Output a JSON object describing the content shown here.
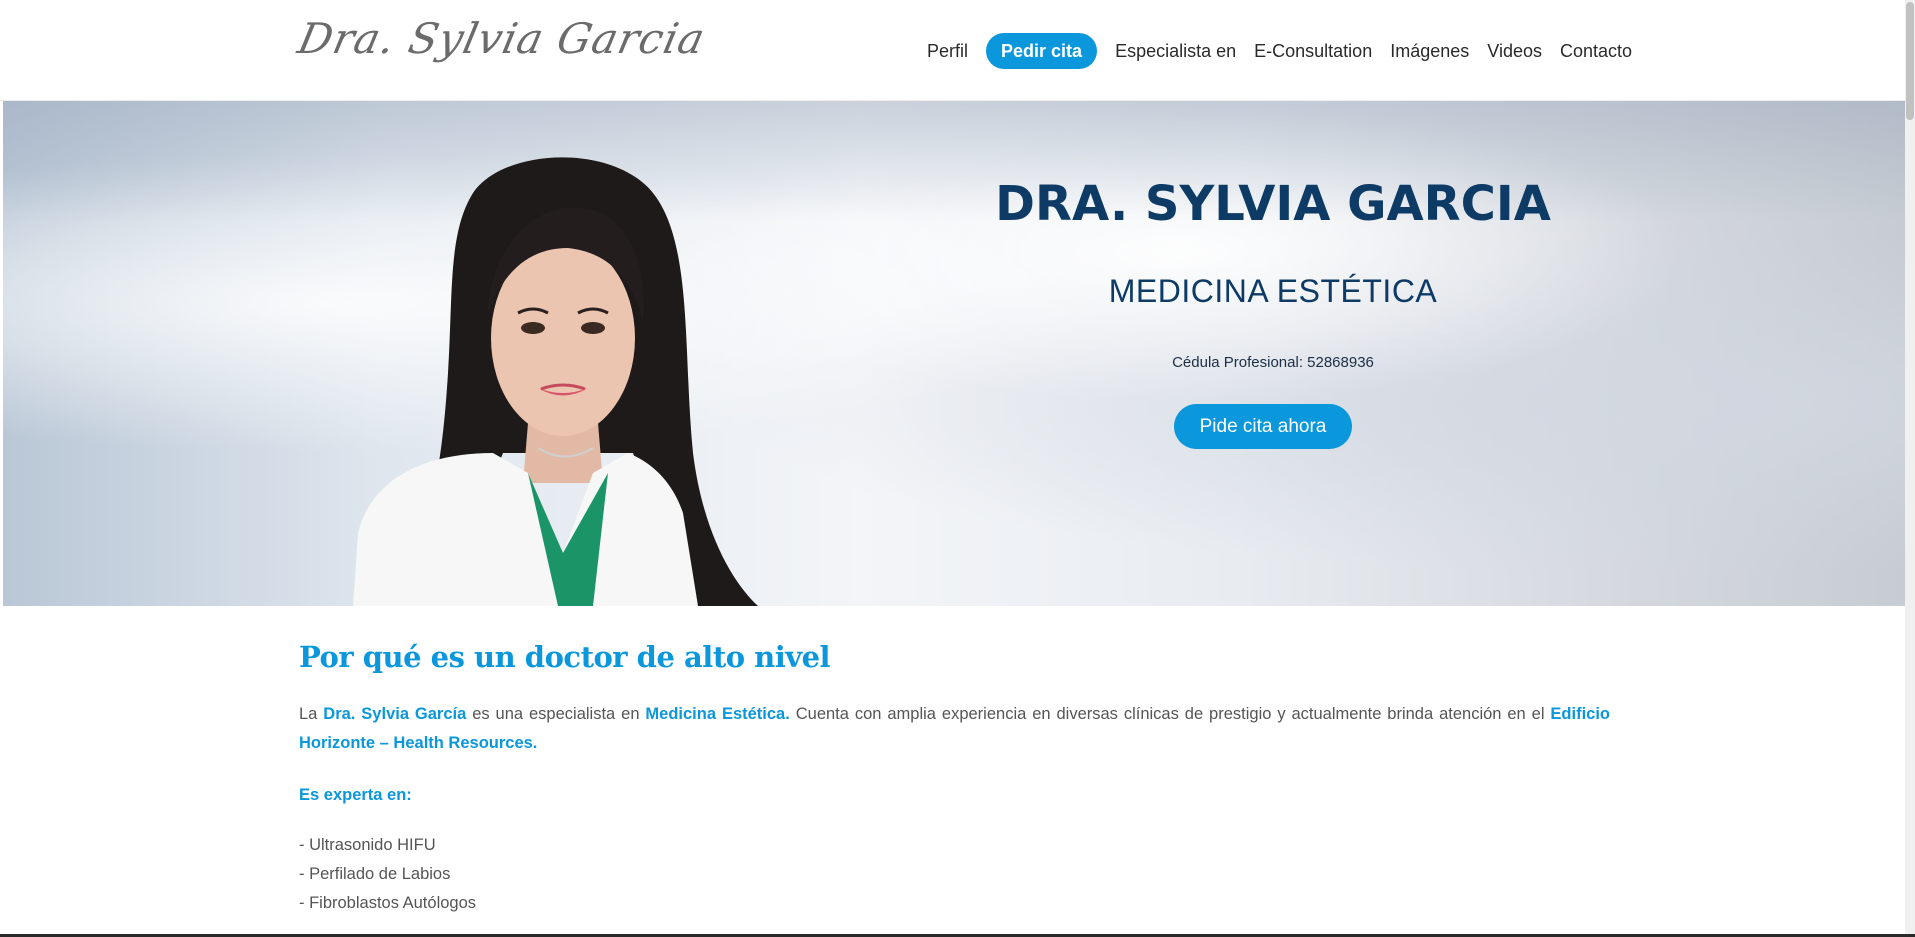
{
  "header": {
    "logo_text": "Dra. Sylvia Garcia",
    "nav": [
      {
        "label": "Perfil"
      },
      {
        "label": "Pedir cita",
        "active": true
      },
      {
        "label": "Especialista en"
      },
      {
        "label": "E-Consultation"
      },
      {
        "label": "Imágenes"
      },
      {
        "label": "Videos"
      },
      {
        "label": "Contacto"
      }
    ]
  },
  "hero": {
    "title": "DRA. SYLVIA GARCIA",
    "subtitle": "MEDICINA ESTÉTICA",
    "cedula": "Cédula Profesional: 52868936",
    "cta": "Pide cita ahora"
  },
  "content": {
    "heading": "Por qué es un doctor de alto nivel",
    "para": {
      "t1": "La ",
      "b1": "Dra. Sylvia García",
      "t2": " es una especialista en ",
      "b2": "Medicina Estética.",
      "t3": " Cuenta con amplia experiencia en diversas clínicas de prestigio y actualmente brinda atención en el ",
      "b3": "Edificio Horizonte – Health Resources."
    },
    "expert_label": "Es experta en:",
    "expert_list": [
      "- Ultrasonido HIFU",
      "- Perfilado de Labios",
      "- Fibroblastos Autólogos"
    ]
  },
  "colors": {
    "accent": "#0a97db",
    "title": "#0d3b66"
  }
}
